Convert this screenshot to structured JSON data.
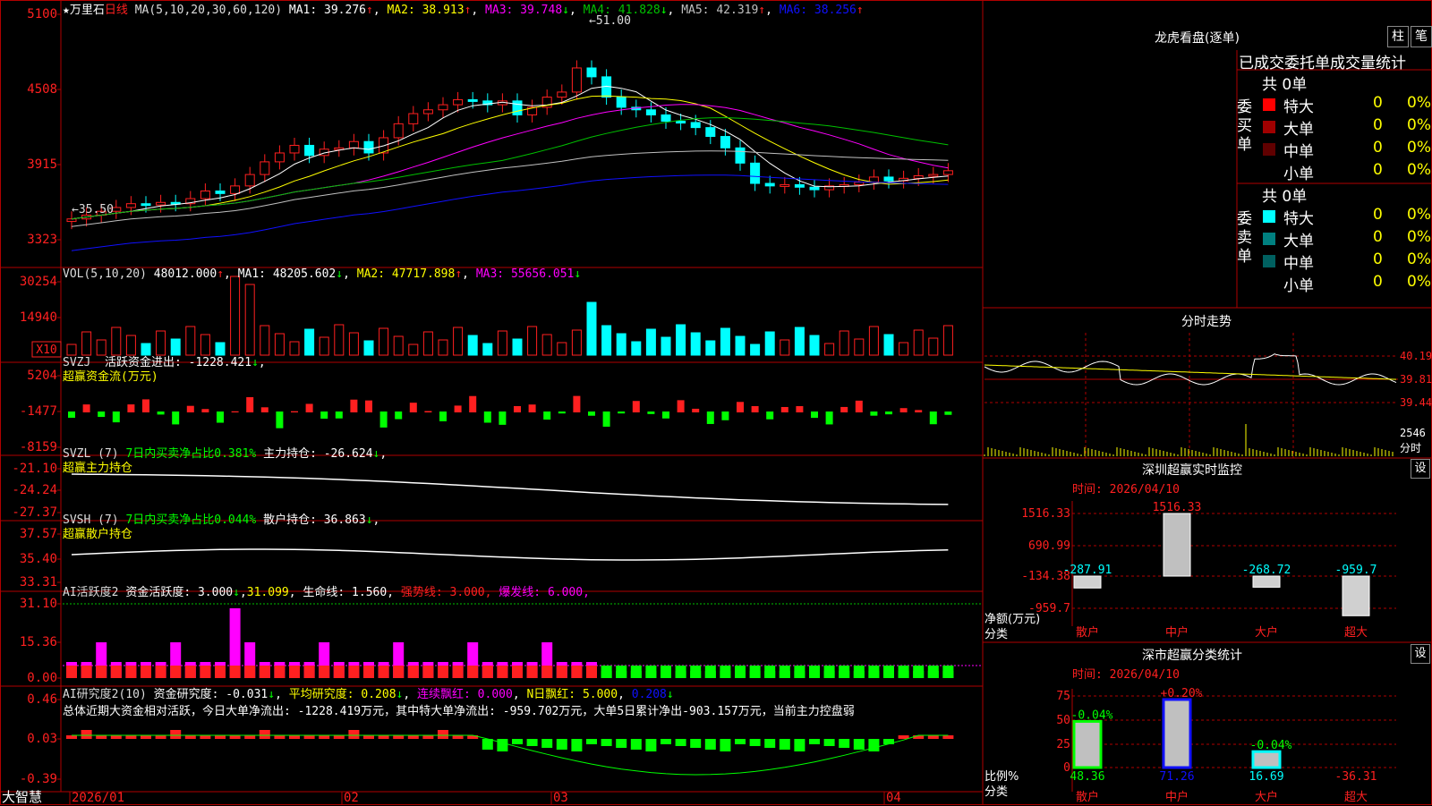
{
  "colors": {
    "up": "#ff2020",
    "down": "#00ffff",
    "grid": "#b00000",
    "ma1": "#ffffff",
    "ma2": "#ffff00",
    "ma3": "#ff00ff",
    "ma4": "#00c000",
    "ma5": "#c0c0c0",
    "ma6": "#1010ff",
    "magenta": "#ff00ff",
    "green": "#00ff00",
    "yellow": "#ffff00"
  },
  "main": {
    "title_name": "万里石",
    "period": "日线",
    "ma_label": "MA(5,10,20,30,60,120)",
    "ma_items": [
      {
        "label": "MA1: 39.276",
        "arrow": "↑",
        "color": "#ffffff",
        "acolor": "#ff2020"
      },
      {
        "label": "MA2: 38.913",
        "arrow": "↑",
        "color": "#ffff00",
        "acolor": "#ff2020"
      },
      {
        "label": "MA3: 39.748",
        "arrow": "↓",
        "color": "#ff00ff",
        "acolor": "#00ff00"
      },
      {
        "label": "MA4: 41.828",
        "arrow": "↓",
        "color": "#00c000",
        "acolor": "#00ff00"
      },
      {
        "label": "MA5: 42.319",
        "arrow": "↑",
        "color": "#c0c0c0",
        "acolor": "#ff2020"
      },
      {
        "label": "MA6: 38.256",
        "arrow": "↑",
        "color": "#1010ff",
        "acolor": "#ff2020"
      }
    ],
    "y_ticks": [
      "5100",
      "4508",
      "3915",
      "3323"
    ],
    "high_label": "51.00",
    "low_label": "35.50"
  },
  "vol": {
    "label": "VOL(5,10,20)",
    "value": "48012.000",
    "items": [
      {
        "label": "MA1: 48205.602",
        "arrow": "↓",
        "color": "#ffffff",
        "acolor": "#00ff00"
      },
      {
        "label": "MA2: 47717.898",
        "arrow": "↑",
        "color": "#ffff00",
        "acolor": "#ff2020"
      },
      {
        "label": "MA3: 55656.051",
        "arrow": "↓",
        "color": "#ff00ff",
        "acolor": "#00ff00"
      }
    ],
    "y_ticks": [
      "30254",
      "14940"
    ],
    "unit": "X10"
  },
  "svzj": {
    "label": "SVZJ",
    "text": "活跃资金进出: -1228.421",
    "arrow": "↓",
    "sub": "超赢资金流(万元)",
    "y_ticks": [
      "5204",
      "-1477",
      "-8159"
    ]
  },
  "svzl": {
    "label": "SVZL (7)",
    "ratio": "7日内买卖净占比0.381%",
    "hold": "主力持仓: -26.624",
    "arrow": "↓",
    "sub": "超赢主力持仓",
    "y_ticks": [
      "-21.10",
      "-24.24",
      "-27.37"
    ]
  },
  "svsh": {
    "label": "SVSH (7)",
    "ratio": "7日内买卖净占比0.044%",
    "hold": "散户持仓: 36.863",
    "arrow": "↓",
    "sub": "超赢散户持仓",
    "y_ticks": [
      "37.57",
      "35.40",
      "33.31"
    ]
  },
  "ai_active": {
    "label": "AI活跃度2",
    "text": "资金活跃度: 3.000",
    "arrow": "↓",
    "v2": "31.099",
    "life": "生命线: 1.560",
    "strong": "强势线: 3.000",
    "burst": "爆发线: 6.000",
    "y_ticks": [
      "31.10",
      "15.36",
      "0.00"
    ]
  },
  "ai_research": {
    "label": "AI研究度2(10)",
    "text": "资金研究度: -0.031",
    "arrow": "↓",
    "avg": "平均研究度: 0.208",
    "red": "连续飘红: 0.000",
    "nday": "N日飘红: 5.000",
    "last": "0.208",
    "summary": "总体近期大资金相对活跃，今日大单净流出: -1228.419万元，其中特大单净流出: -959.702万元，大单5日累计净出-903.157万元，当前主力控盘弱",
    "y_ticks": [
      "0.46",
      "0.03",
      "-0.39"
    ]
  },
  "x_axis": {
    "corner": "大智慧",
    "labels": [
      "2026/01",
      "02",
      "03",
      "04"
    ]
  },
  "panel": {
    "title": "龙虎看盘(逐单)",
    "btn1": "柱",
    "btn2": "笔",
    "subtitle": "已成交委托单成交量统计",
    "buy": {
      "side": "委买单",
      "total": "共 0单",
      "rows": [
        {
          "name": "特大",
          "val": "0",
          "pct": "0%",
          "color": "#ff0000"
        },
        {
          "name": "大单",
          "val": "0",
          "pct": "0%",
          "color": "#a00000"
        },
        {
          "name": "中单",
          "val": "0",
          "pct": "0%",
          "color": "#600000"
        },
        {
          "name": "小单",
          "val": "0",
          "pct": "0%",
          "color": "#000000"
        }
      ]
    },
    "sell": {
      "side": "委卖单",
      "total": "共 0单",
      "rows": [
        {
          "name": "特大",
          "val": "0",
          "pct": "0%",
          "color": "#00ffff"
        },
        {
          "name": "大单",
          "val": "0",
          "pct": "0%",
          "color": "#008080"
        },
        {
          "name": "中单",
          "val": "0",
          "pct": "0%",
          "color": "#006060"
        },
        {
          "name": "小单",
          "val": "0",
          "pct": "0%",
          "color": "#000000"
        }
      ]
    },
    "minute": {
      "title": "分时走势",
      "y_ticks": [
        "40.19",
        "39.81",
        "39.44"
      ],
      "vol_label": "2546",
      "vol_sub": "分时"
    },
    "monitor": {
      "title": "深圳超赢实时监控",
      "set": "设",
      "date": "时间: 2026/04/10",
      "y_ticks": [
        "1516.33",
        "690.99",
        "-134.38",
        "-959.7"
      ],
      "ylabel": "净额(万元)",
      "xlabel": "分类",
      "chart_data": {
        "type": "bar",
        "categories": [
          "散户",
          "中户",
          "大户",
          "超大"
        ],
        "values": [
          -287.91,
          1516.33,
          -268.72,
          -959.7
        ],
        "value_labels": [
          "-287.91",
          "1516.33",
          "-268.72",
          "-959.7"
        ],
        "ylim": [
          -959.7,
          1516.33
        ]
      }
    },
    "stats": {
      "title": "深市超赢分类统计",
      "set": "设",
      "date": "时间: 2026/04/10",
      "y_ticks": [
        "75",
        "50",
        "25",
        "0"
      ],
      "ylabel": "比例%",
      "xlabel": "分类",
      "chart_data": {
        "type": "bar",
        "categories": [
          "散户",
          "中户",
          "大户",
          "超大"
        ],
        "values": [
          48.36,
          71.26,
          16.69,
          -36.31
        ],
        "value_labels": [
          "48.36",
          "71.26",
          "16.69",
          "-36.31"
        ],
        "top_labels": [
          "-0.04%",
          "+0.20%",
          "-0.04%",
          ""
        ],
        "ylim": [
          0,
          75
        ]
      }
    }
  }
}
